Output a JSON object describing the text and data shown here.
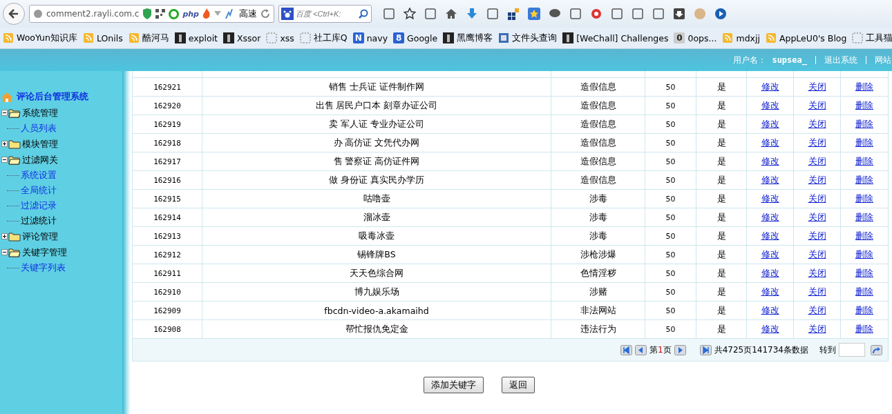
{
  "browser": {
    "url": "comment2.rayli.com.c",
    "badge": "php",
    "speed_label": "高速",
    "search_placeholder": "百度 <Ctrl+K:",
    "bookmarks": [
      {
        "label": "WooYun知识库",
        "kind": "feed"
      },
      {
        "label": "LOnils",
        "kind": "feed"
      },
      {
        "label": "酷河马",
        "kind": "feed"
      },
      {
        "label": "exploit",
        "kind": "dark"
      },
      {
        "label": "Xssor",
        "kind": "dark"
      },
      {
        "label": "xss",
        "kind": "blank"
      },
      {
        "label": "社工库Q",
        "kind": "blank"
      },
      {
        "label": "navy",
        "kind": "letter",
        "glyph": "N"
      },
      {
        "label": "Google",
        "kind": "letter",
        "glyph": "8"
      },
      {
        "label": "黑鹰博客",
        "kind": "dark"
      },
      {
        "label": "文件头查询",
        "kind": "page"
      },
      {
        "label": "[WeChall] Challenges",
        "kind": "dark"
      },
      {
        "label": "0ops...",
        "kind": "letter",
        "glyph": "0"
      },
      {
        "label": "mdxjj",
        "kind": "feed"
      },
      {
        "label": "AppLeU0's Blog",
        "kind": "feed"
      },
      {
        "label": "工具猫",
        "kind": "blank"
      }
    ]
  },
  "header": {
    "user_label": "用户名：",
    "username": "supsea_",
    "links": [
      "退出系统",
      "网站"
    ]
  },
  "sidebar": {
    "title": "评论后台管理系统",
    "items": [
      {
        "label": "系统管理",
        "expanded": true,
        "children": [
          {
            "label": "人员列表",
            "selected": false
          }
        ]
      },
      {
        "label": "模块管理",
        "expanded": false
      },
      {
        "label": "过滤网关",
        "expanded": true,
        "children": [
          {
            "label": "系统设置",
            "selected": false
          },
          {
            "label": "全局统计",
            "selected": false
          },
          {
            "label": "过滤记录",
            "selected": false
          },
          {
            "label": "过滤统计",
            "selected": true
          }
        ]
      },
      {
        "label": "评论管理",
        "expanded": false
      },
      {
        "label": "关键字管理",
        "expanded": true,
        "children": [
          {
            "label": "关键字列表",
            "selected": false
          }
        ]
      }
    ]
  },
  "table": {
    "rows": [
      {
        "id": "162921",
        "keyword": "销售 士兵证 证件制作网",
        "category": "造假信息",
        "column_4": "50",
        "column_5": "是",
        "actions": [
          "修改",
          "关闭",
          "删除"
        ]
      },
      {
        "id": "162920",
        "keyword": "出售 居民户口本 刻章办证公司",
        "category": "造假信息",
        "column_4": "50",
        "column_5": "是",
        "actions": [
          "修改",
          "关闭",
          "删除"
        ]
      },
      {
        "id": "162919",
        "keyword": "卖 军人证 专业办证公司",
        "category": "造假信息",
        "column_4": "50",
        "column_5": "是",
        "actions": [
          "修改",
          "关闭",
          "删除"
        ]
      },
      {
        "id": "162918",
        "keyword": "办 高仿证 文凭代办网",
        "category": "造假信息",
        "column_4": "50",
        "column_5": "是",
        "actions": [
          "修改",
          "关闭",
          "删除"
        ]
      },
      {
        "id": "162917",
        "keyword": "售 警察证 高仿证件网",
        "category": "造假信息",
        "column_4": "50",
        "column_5": "是",
        "actions": [
          "修改",
          "关闭",
          "删除"
        ]
      },
      {
        "id": "162916",
        "keyword": "做 身份证 真实民办学历",
        "category": "造假信息",
        "column_4": "50",
        "column_5": "是",
        "actions": [
          "修改",
          "关闭",
          "删除"
        ]
      },
      {
        "id": "162915",
        "keyword": "咕噜壶",
        "category": "涉毒",
        "column_4": "50",
        "column_5": "是",
        "actions": [
          "修改",
          "关闭",
          "删除"
        ]
      },
      {
        "id": "162914",
        "keyword": "溜冰壶",
        "category": "涉毒",
        "column_4": "50",
        "column_5": "是",
        "actions": [
          "修改",
          "关闭",
          "删除"
        ]
      },
      {
        "id": "162913",
        "keyword": "吸毒冰壶",
        "category": "涉毒",
        "column_4": "50",
        "column_5": "是",
        "actions": [
          "修改",
          "关闭",
          "删除"
        ]
      },
      {
        "id": "162912",
        "keyword": "锡锋牌BS",
        "category": "涉枪涉爆",
        "column_4": "50",
        "column_5": "是",
        "actions": [
          "修改",
          "关闭",
          "删除"
        ]
      },
      {
        "id": "162911",
        "keyword": "天天色综合网",
        "category": "色情淫秽",
        "column_4": "50",
        "column_5": "是",
        "actions": [
          "修改",
          "关闭",
          "删除"
        ]
      },
      {
        "id": "162910",
        "keyword": "博九娱乐场",
        "category": "涉赌",
        "column_4": "50",
        "column_5": "是",
        "actions": [
          "修改",
          "关闭",
          "删除"
        ]
      },
      {
        "id": "162909",
        "keyword": "fbcdn-video-a.akamaihd",
        "category": "非法网站",
        "column_4": "50",
        "column_5": "是",
        "actions": [
          "修改",
          "关闭",
          "删除"
        ]
      },
      {
        "id": "162908",
        "keyword": "帮忙报仇免定金",
        "category": "违法行为",
        "column_4": "50",
        "column_5": "是",
        "actions": [
          "修改",
          "关闭",
          "删除"
        ]
      }
    ]
  },
  "pagination": {
    "page_prefix": "第",
    "page": "1",
    "page_suffix": "页",
    "summary": "共4725页141734条数据",
    "goto_label": "转到"
  },
  "buttons": [
    "添加关键字",
    "返回"
  ]
}
